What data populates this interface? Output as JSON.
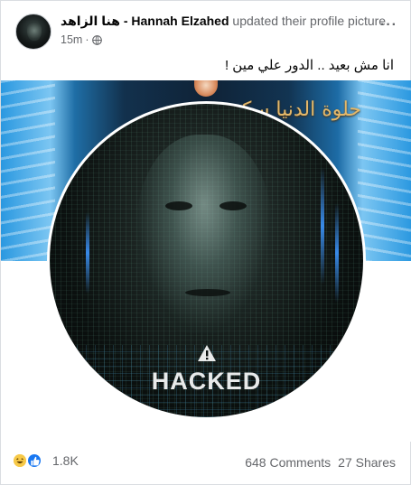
{
  "post": {
    "author_name": "هنا الزاهد - Hannah Elzahed",
    "author_action": "updated their profile picture.",
    "timestamp": "15m",
    "separator": "·",
    "privacy_icon": "globe-icon",
    "more_icon": "more-options-icon",
    "more_label": "···",
    "caption": "انا مش بعيد .. الدور علي مين !"
  },
  "photo": {
    "cover_text": "حلوة الدنيا سكر",
    "profile_text": "HACKED",
    "warning_icon": "warning-icon"
  },
  "footer": {
    "reaction_icons": [
      "haha-icon",
      "like-icon"
    ],
    "reaction_count": "1.8K",
    "comments": "648 Comments",
    "shares": "27 Shares"
  },
  "colors": {
    "facebook_blue": "#1877f2",
    "secondary_text": "#65676b",
    "haha_yellow": "#f7c948"
  }
}
